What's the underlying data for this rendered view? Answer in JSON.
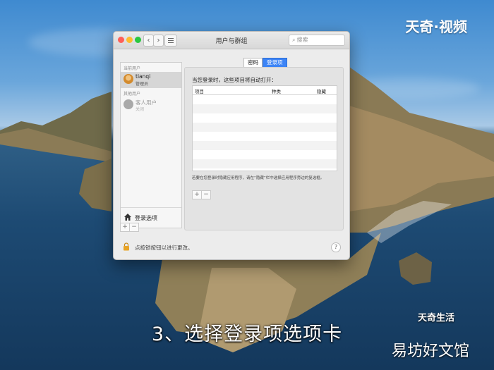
{
  "watermark_top": "天奇·视频",
  "caption": "3、选择登录项选项卡",
  "watermark_bottom_small": "天奇生活",
  "watermark_bottom": "易坊好文馆",
  "window": {
    "title": "用户与群组",
    "search_placeholder": "搜索",
    "nav_back": "‹",
    "nav_forward": "›",
    "sidebar": {
      "current_users_header": "当前用户",
      "current_user": {
        "name": "tianqi",
        "role": "管理员"
      },
      "other_users_header": "其他用户",
      "guest_user": {
        "name": "客人用户",
        "role": "关闭"
      },
      "login_options_label": "登录选项",
      "add": "+",
      "remove": "−"
    },
    "tabs": [
      "密码",
      "登录项"
    ],
    "active_tab": "登录项",
    "login_items": {
      "description": "当您登录时，这些项目将自动打开：",
      "columns": [
        "项目",
        "种类",
        "隐藏"
      ],
      "hint": "若要在您登录时隐藏应用程序，请在“隐藏”栏中选择应用程序旁边的复选框。",
      "add": "+",
      "remove": "−"
    },
    "lock_text": "点按锁按钮以进行更改。",
    "help": "?"
  },
  "colors": {
    "accent": "#3c84f6",
    "close": "#fe5f57",
    "minimize": "#febc2e",
    "maximize": "#28c840"
  }
}
